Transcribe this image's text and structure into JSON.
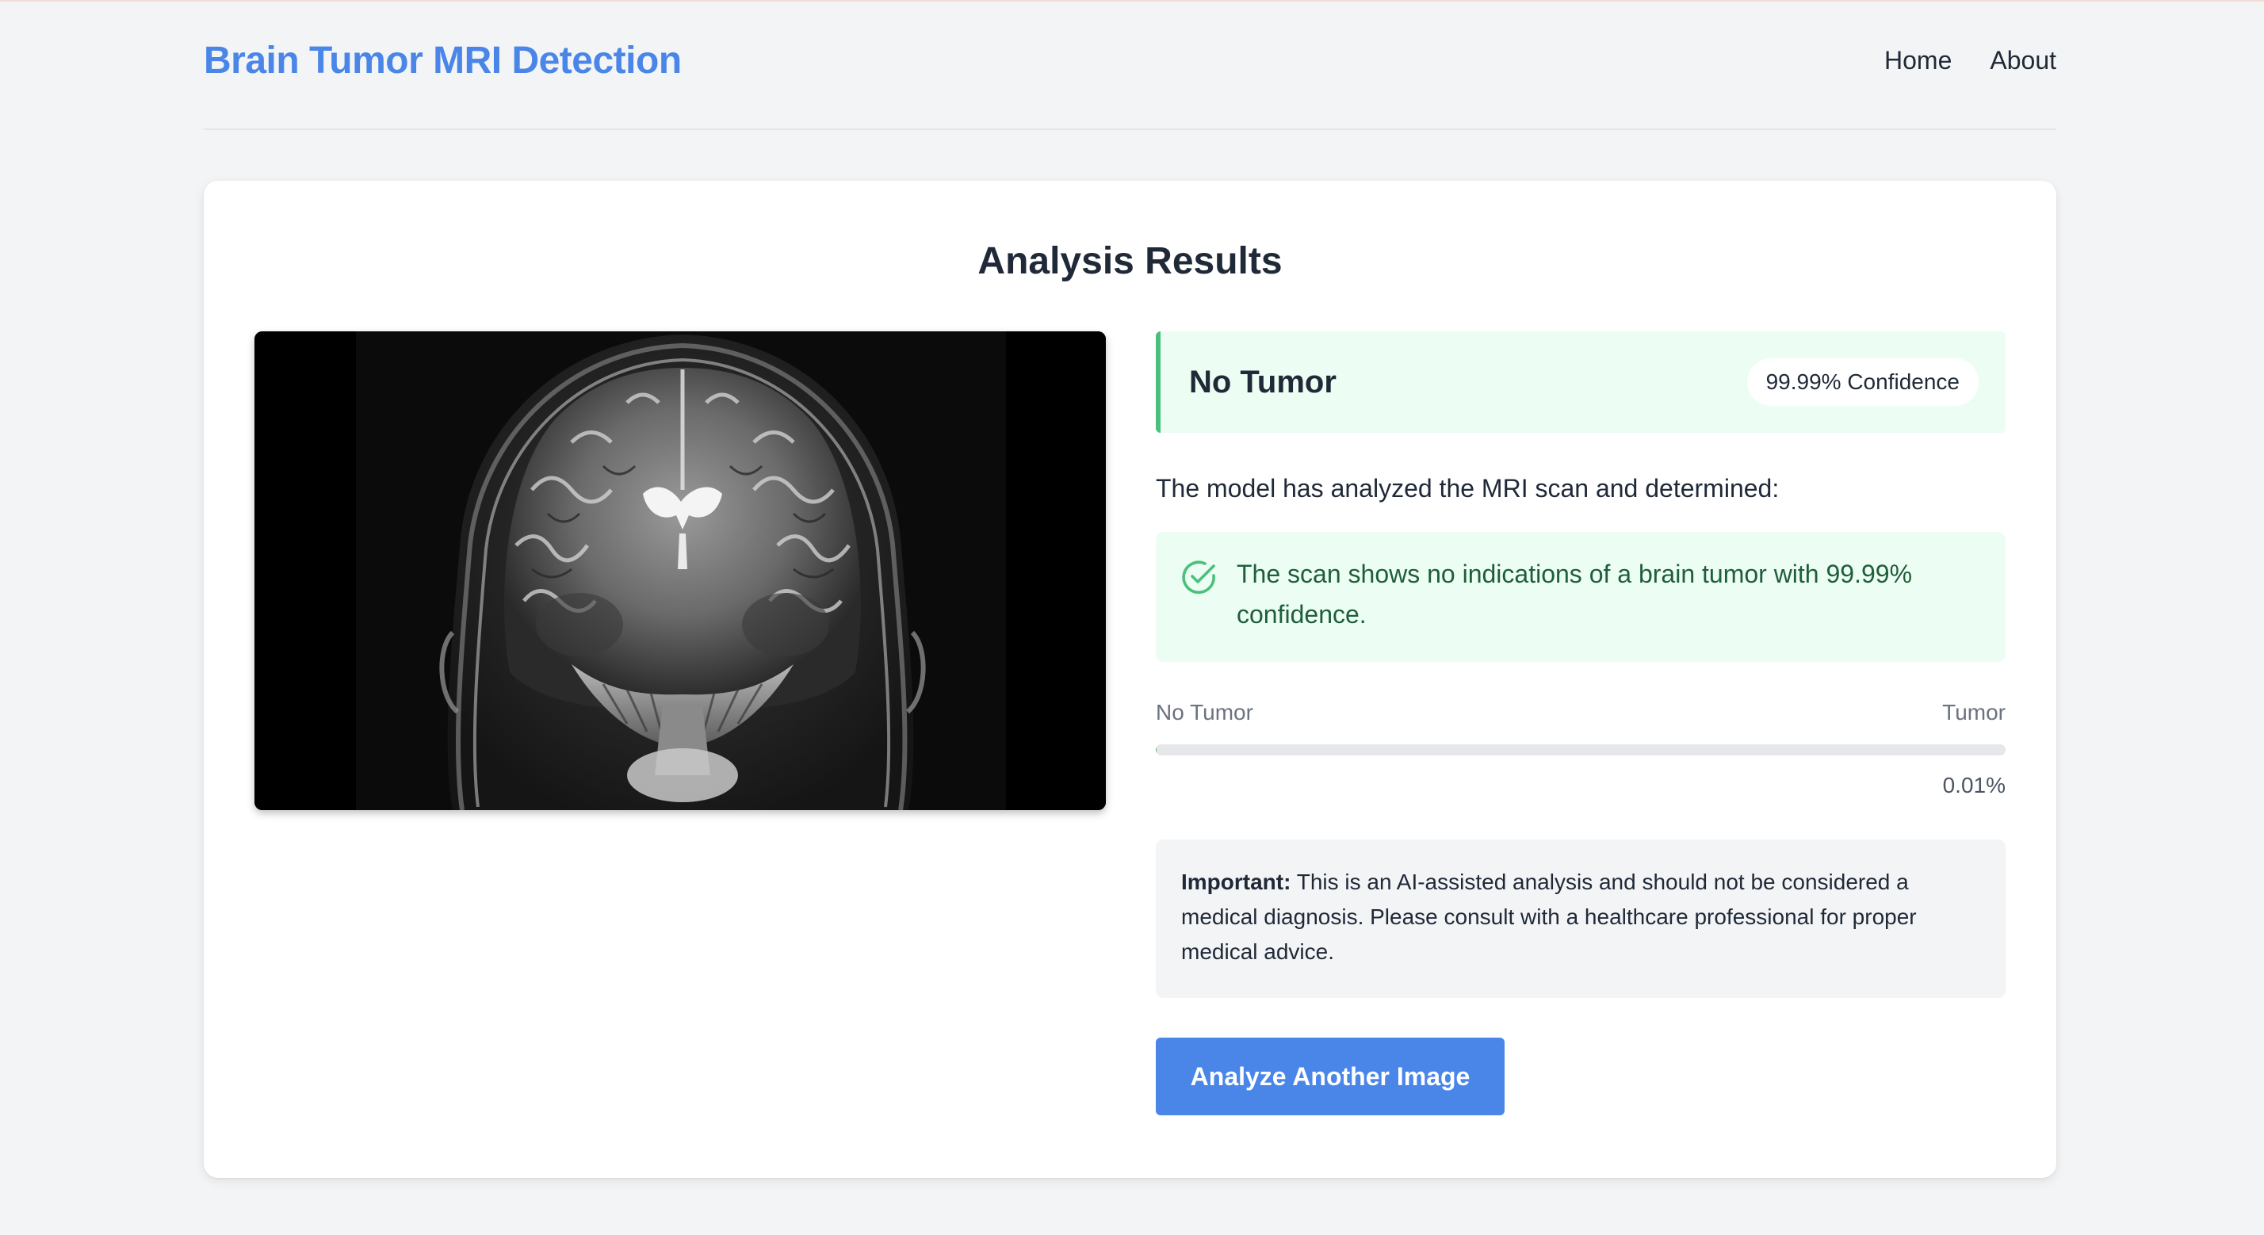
{
  "header": {
    "brand": "Brain Tumor MRI Detection",
    "nav": [
      {
        "label": "Home"
      },
      {
        "label": "About"
      }
    ]
  },
  "main": {
    "title": "Analysis Results",
    "result": {
      "label": "No Tumor",
      "confidence": "99.99% Confidence",
      "status_color": "#4bbf7d"
    },
    "lead": "The model has analyzed the MRI scan and determined:",
    "note": {
      "icon": "check-circle-icon",
      "text": "The scan shows no indications of a brain tumor with 99.99% confidence."
    },
    "scale": {
      "left_label": "No Tumor",
      "right_label": "Tumor",
      "value_text": "0.01%",
      "tumor_probability": 0.0001
    },
    "disclaimer": {
      "bold": "Important:",
      "text": " This is an AI-assisted analysis and should not be considered a medical diagnosis. Please consult with a healthcare professional for proper medical advice."
    },
    "button": {
      "label": "Analyze Another Image"
    }
  },
  "colors": {
    "brand": "#4a86e8",
    "success_bg": "#ecfdf3",
    "success": "#4bbf7d",
    "page_bg": "#f3f4f6"
  }
}
